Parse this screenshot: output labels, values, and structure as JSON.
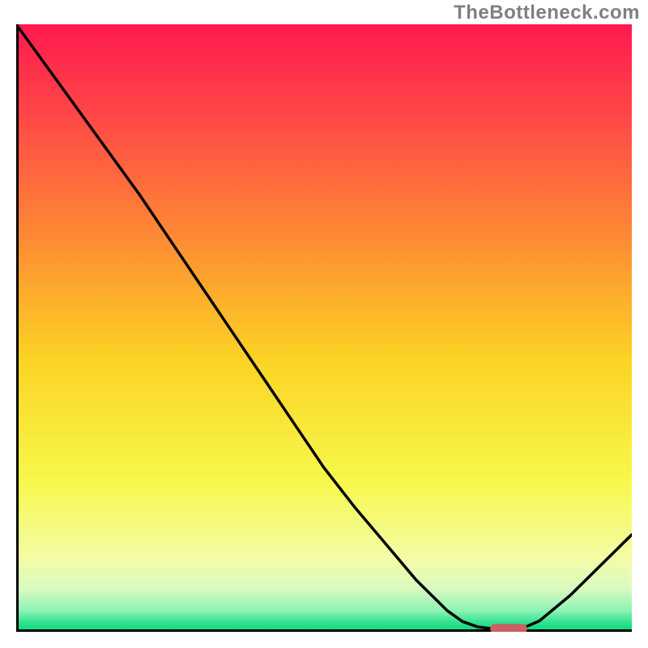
{
  "watermark": "TheBottleneck.com",
  "chart_data": {
    "type": "line",
    "title": "",
    "xlabel": "",
    "ylabel": "",
    "x": [
      0.0,
      0.05,
      0.1,
      0.15,
      0.2,
      0.25,
      0.3,
      0.35,
      0.4,
      0.45,
      0.5,
      0.55,
      0.6,
      0.65,
      0.7,
      0.725,
      0.75,
      0.775,
      0.8,
      0.825,
      0.85,
      0.9,
      0.95,
      1.0
    ],
    "values": [
      1.0,
      0.93,
      0.86,
      0.79,
      0.72,
      0.645,
      0.57,
      0.495,
      0.42,
      0.345,
      0.27,
      0.205,
      0.145,
      0.085,
      0.035,
      0.017,
      0.008,
      0.005,
      0.005,
      0.007,
      0.018,
      0.06,
      0.11,
      0.16
    ],
    "xlim": [
      0,
      1
    ],
    "ylim": [
      0,
      1
    ],
    "marker": {
      "x_range": [
        0.77,
        0.83
      ],
      "y": 0.005,
      "color": "#cb5f61"
    },
    "gradient_stops": [
      {
        "offset": 0.0,
        "color": "#ff1a4f"
      },
      {
        "offset": 0.15,
        "color": "#ff4747"
      },
      {
        "offset": 0.35,
        "color": "#fe8a34"
      },
      {
        "offset": 0.55,
        "color": "#fbd324"
      },
      {
        "offset": 0.75,
        "color": "#f7f84a"
      },
      {
        "offset": 0.88,
        "color": "#f4fca6"
      },
      {
        "offset": 0.93,
        "color": "#d8fac0"
      },
      {
        "offset": 0.965,
        "color": "#8ef3b4"
      },
      {
        "offset": 0.985,
        "color": "#2ee28f"
      },
      {
        "offset": 1.0,
        "color": "#06d67c"
      }
    ]
  }
}
